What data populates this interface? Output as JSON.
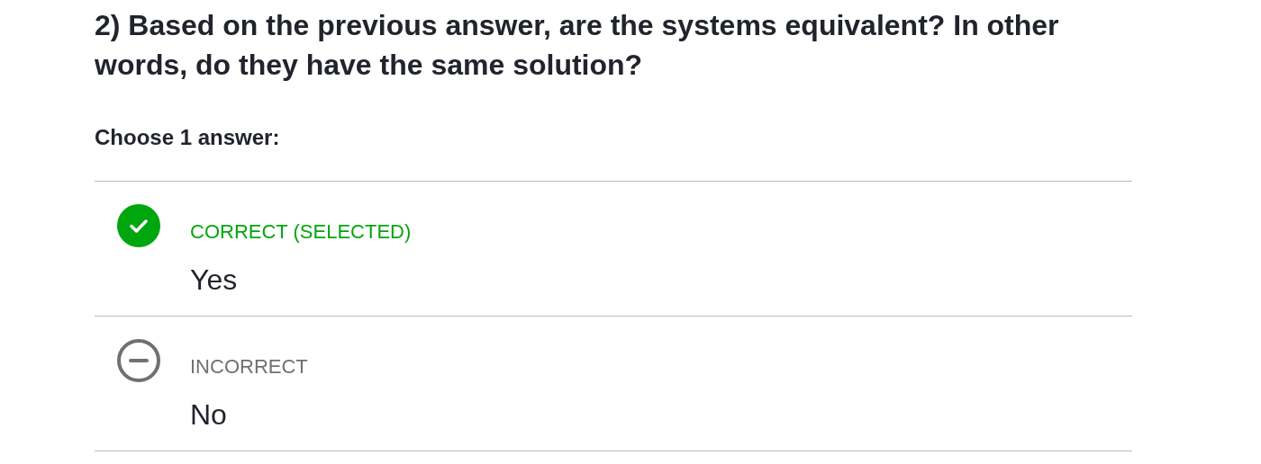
{
  "question": "2) Based on the previous answer, are the systems equivalent? In other words, do they have the same solution?",
  "prompt": "Choose 1 answer:",
  "options": [
    {
      "kind": "correct",
      "selected": true,
      "status": "CORRECT (SELECTED)",
      "text": "Yes"
    },
    {
      "kind": "incorrect",
      "selected": false,
      "status": "INCORRECT",
      "text": "No"
    }
  ]
}
